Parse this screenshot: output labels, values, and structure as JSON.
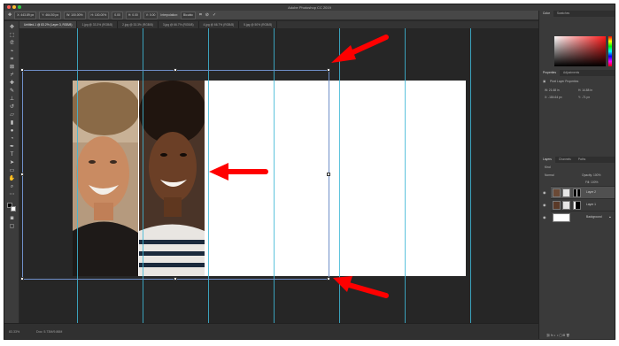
{
  "window": {
    "title": "Adobe Photoshop CC 2019"
  },
  "options_bar": {
    "items": [
      "X: 443.89 px",
      "Y: 464.50 px",
      "W: 100.00%",
      "H: 100.00%",
      "0.00",
      "H: 0.00",
      "V: 0.00",
      "Interpolation:",
      "Bicubic"
    ]
  },
  "tabs": [
    "Untitled-1 @ 83.2% (Layer 3, RGB/8)",
    "1.jpg @ 33.3% (RGB/8)",
    "2.jpg @ 33.3% (RGB/8)",
    "3.jpg @ 66.7% (RGB/8)",
    "4.jpg @ 66.7% (RGB/8)",
    "5.jpg @ 50% (RGB/8)"
  ],
  "status": {
    "zoom": "83.33%",
    "doc": "Doc: 5.73M/9.86M"
  },
  "panels": {
    "color_tabs": [
      "Color",
      "Swatches"
    ],
    "properties_tabs": [
      "Properties",
      "Adjustments"
    ],
    "properties_title": "Pixel Layer Properties",
    "w_value": "W: 21.68 in",
    "h_value": "H: 14.88 in",
    "x_value": "X: -184.64 px",
    "y_value": "Y: -71 px",
    "layers_tabs": [
      "Layers",
      "Channels",
      "Paths"
    ],
    "kind_label": "Kind",
    "blend_mode": "Normal",
    "opacity": "Opacity: 100%",
    "fill": "Fill: 100%",
    "layers": [
      "Layer 2",
      "Layer 1",
      "Background"
    ]
  },
  "colors": {
    "guide": "#3fb7d6",
    "arrow": "#ff0000",
    "accent_red": "#ff1a1a"
  }
}
